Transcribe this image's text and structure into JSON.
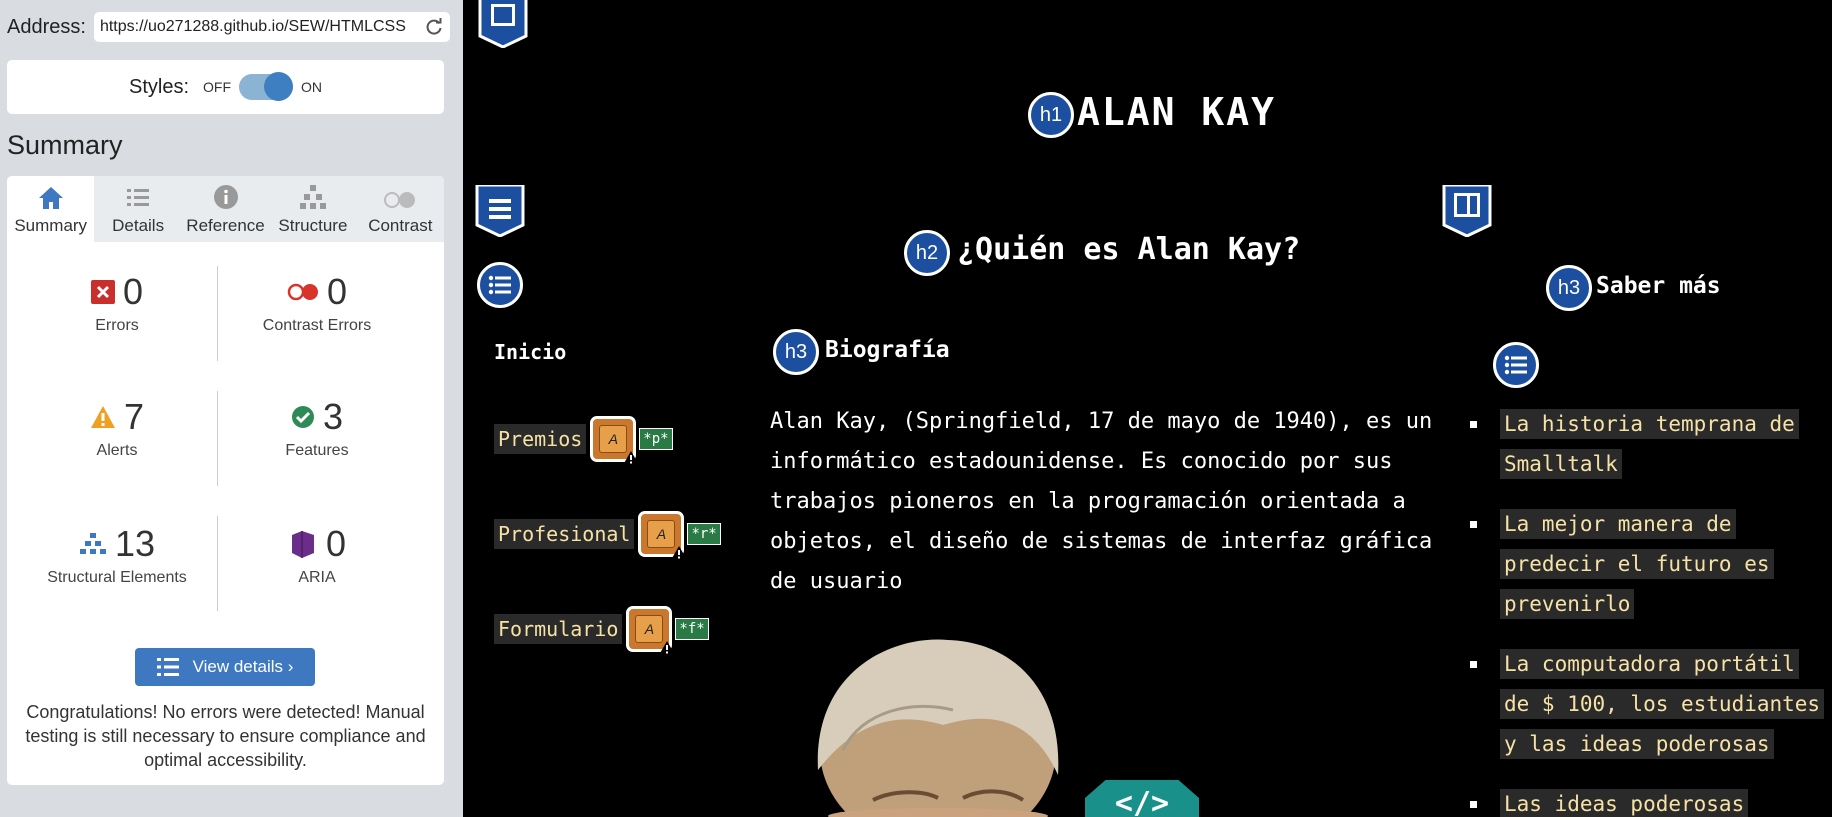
{
  "panel": {
    "address_label": "Address:",
    "address_value": "https://uo271288.github.io/SEW/HTMLCSS",
    "styles_label": "Styles:",
    "styles_off": "OFF",
    "styles_on": "ON",
    "summary_heading": "Summary",
    "tabs": [
      {
        "label": "Summary",
        "icon": "home-icon"
      },
      {
        "label": "Details",
        "icon": "list-icon"
      },
      {
        "label": "Reference",
        "icon": "info-icon"
      },
      {
        "label": "Structure",
        "icon": "hierarchy-icon"
      },
      {
        "label": "Contrast",
        "icon": "contrast-icon"
      }
    ],
    "stats": {
      "errors": {
        "value": "0",
        "label": "Errors"
      },
      "contrast_errors": {
        "value": "0",
        "label": "Contrast Errors"
      },
      "alerts": {
        "value": "7",
        "label": "Alerts"
      },
      "features": {
        "value": "3",
        "label": "Features"
      },
      "structural": {
        "value": "13",
        "label": "Structural Elements"
      },
      "aria": {
        "value": "0",
        "label": "ARIA"
      }
    },
    "view_details": "View details ›",
    "congrats": "Congratulations! No errors were detected! Manual testing is still necessary to ensure compliance and optimal accessibility."
  },
  "page": {
    "h1_badge": "h1",
    "h1": "ALAN KAY",
    "h2_badge": "h2",
    "h2": "¿Quién es Alan Kay?",
    "h3_bio_badge": "h3",
    "h3_bio": "Biografía",
    "h3_more_badge": "h3",
    "h3_more": "Saber más",
    "nav_title": "Inicio",
    "nav": [
      {
        "label": "Premios",
        "tag": "*p*"
      },
      {
        "label": "Profesional",
        "tag": "*r*"
      },
      {
        "label": "Formulario",
        "tag": "*f*"
      }
    ],
    "a_icon_letter": "A",
    "paragraph": "Alan Kay, (Springfield, 17 de mayo de 1940), es un informático estadounidense. Es conocido por sus trabajos pioneros en la programación orientada a objetos, el diseño de sistemas de interfaz gráfica de usuario",
    "links": [
      "La historia temprana de Smalltalk",
      "La mejor manera de predecir el futuro es prevenirlo",
      "La computadora portátil de $ 100, los estudiantes y las ideas poderosas",
      "Las ideas poderosas"
    ],
    "code_badge": "</>"
  },
  "colors": {
    "panel_bg": "#d9dde2",
    "accent": "#3d78c0",
    "page_bg": "#000000",
    "link_text": "#f7e2a6",
    "badge_blue": "#1d4fa0"
  }
}
